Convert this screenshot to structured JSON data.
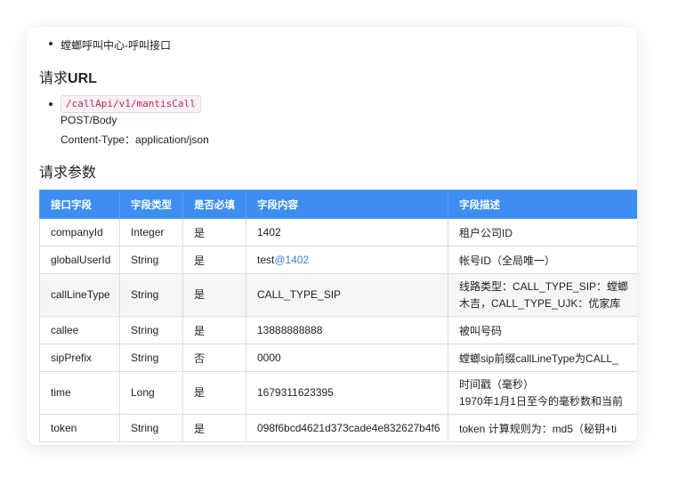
{
  "bullet_top": "螳螂呼叫中心-呼叫接口",
  "url_section": {
    "heading_prefix": "请求",
    "heading_bold": "URL",
    "path": "/callApi/v1/mantisCall",
    "method": "POST/Body",
    "content_type": "Content-Type：application/json"
  },
  "params_heading": "请求参数",
  "table": {
    "headers": [
      "接口字段",
      "字段类型",
      "是否必填",
      "字段内容",
      "字段描述"
    ],
    "rows": [
      {
        "field": "companyId",
        "type": "Integer",
        "required": "是",
        "content": "1402",
        "content_link": "",
        "desc": [
          "租户公司ID"
        ]
      },
      {
        "field": "globalUserId",
        "type": "String",
        "required": "是",
        "content": "test",
        "content_link": "@1402",
        "desc": [
          "帐号ID（全局唯一）"
        ]
      },
      {
        "field": "callLineType",
        "type": "String",
        "required": "是",
        "content": "CALL_TYPE_SIP",
        "content_link": "",
        "desc": [
          "线路类型：CALL_TYPE_SIP：螳螂",
          "木吉，CALL_TYPE_UJK：优家库"
        ]
      },
      {
        "field": "callee",
        "type": "String",
        "required": "是",
        "content": "13888888888",
        "content_link": "",
        "desc": [
          "被叫号码"
        ]
      },
      {
        "field": "sipPrefix",
        "type": "String",
        "required": "否",
        "content": "0000",
        "content_link": "",
        "desc": [
          "螳螂sip前缀callLineType为CALL_"
        ]
      },
      {
        "field": "time",
        "type": "Long",
        "required": "是",
        "content": "1679311623395",
        "content_link": "",
        "desc": [
          "时间戳（毫秒）",
          "1970年1月1日至今的毫秒数和当前"
        ]
      },
      {
        "field": "token",
        "type": "String",
        "required": "是",
        "content": "098f6bcd4621d373cade4e832627b4f6",
        "content_link": "",
        "desc": [
          "token 计算规则为：md5（秘钥+ti"
        ]
      }
    ]
  }
}
